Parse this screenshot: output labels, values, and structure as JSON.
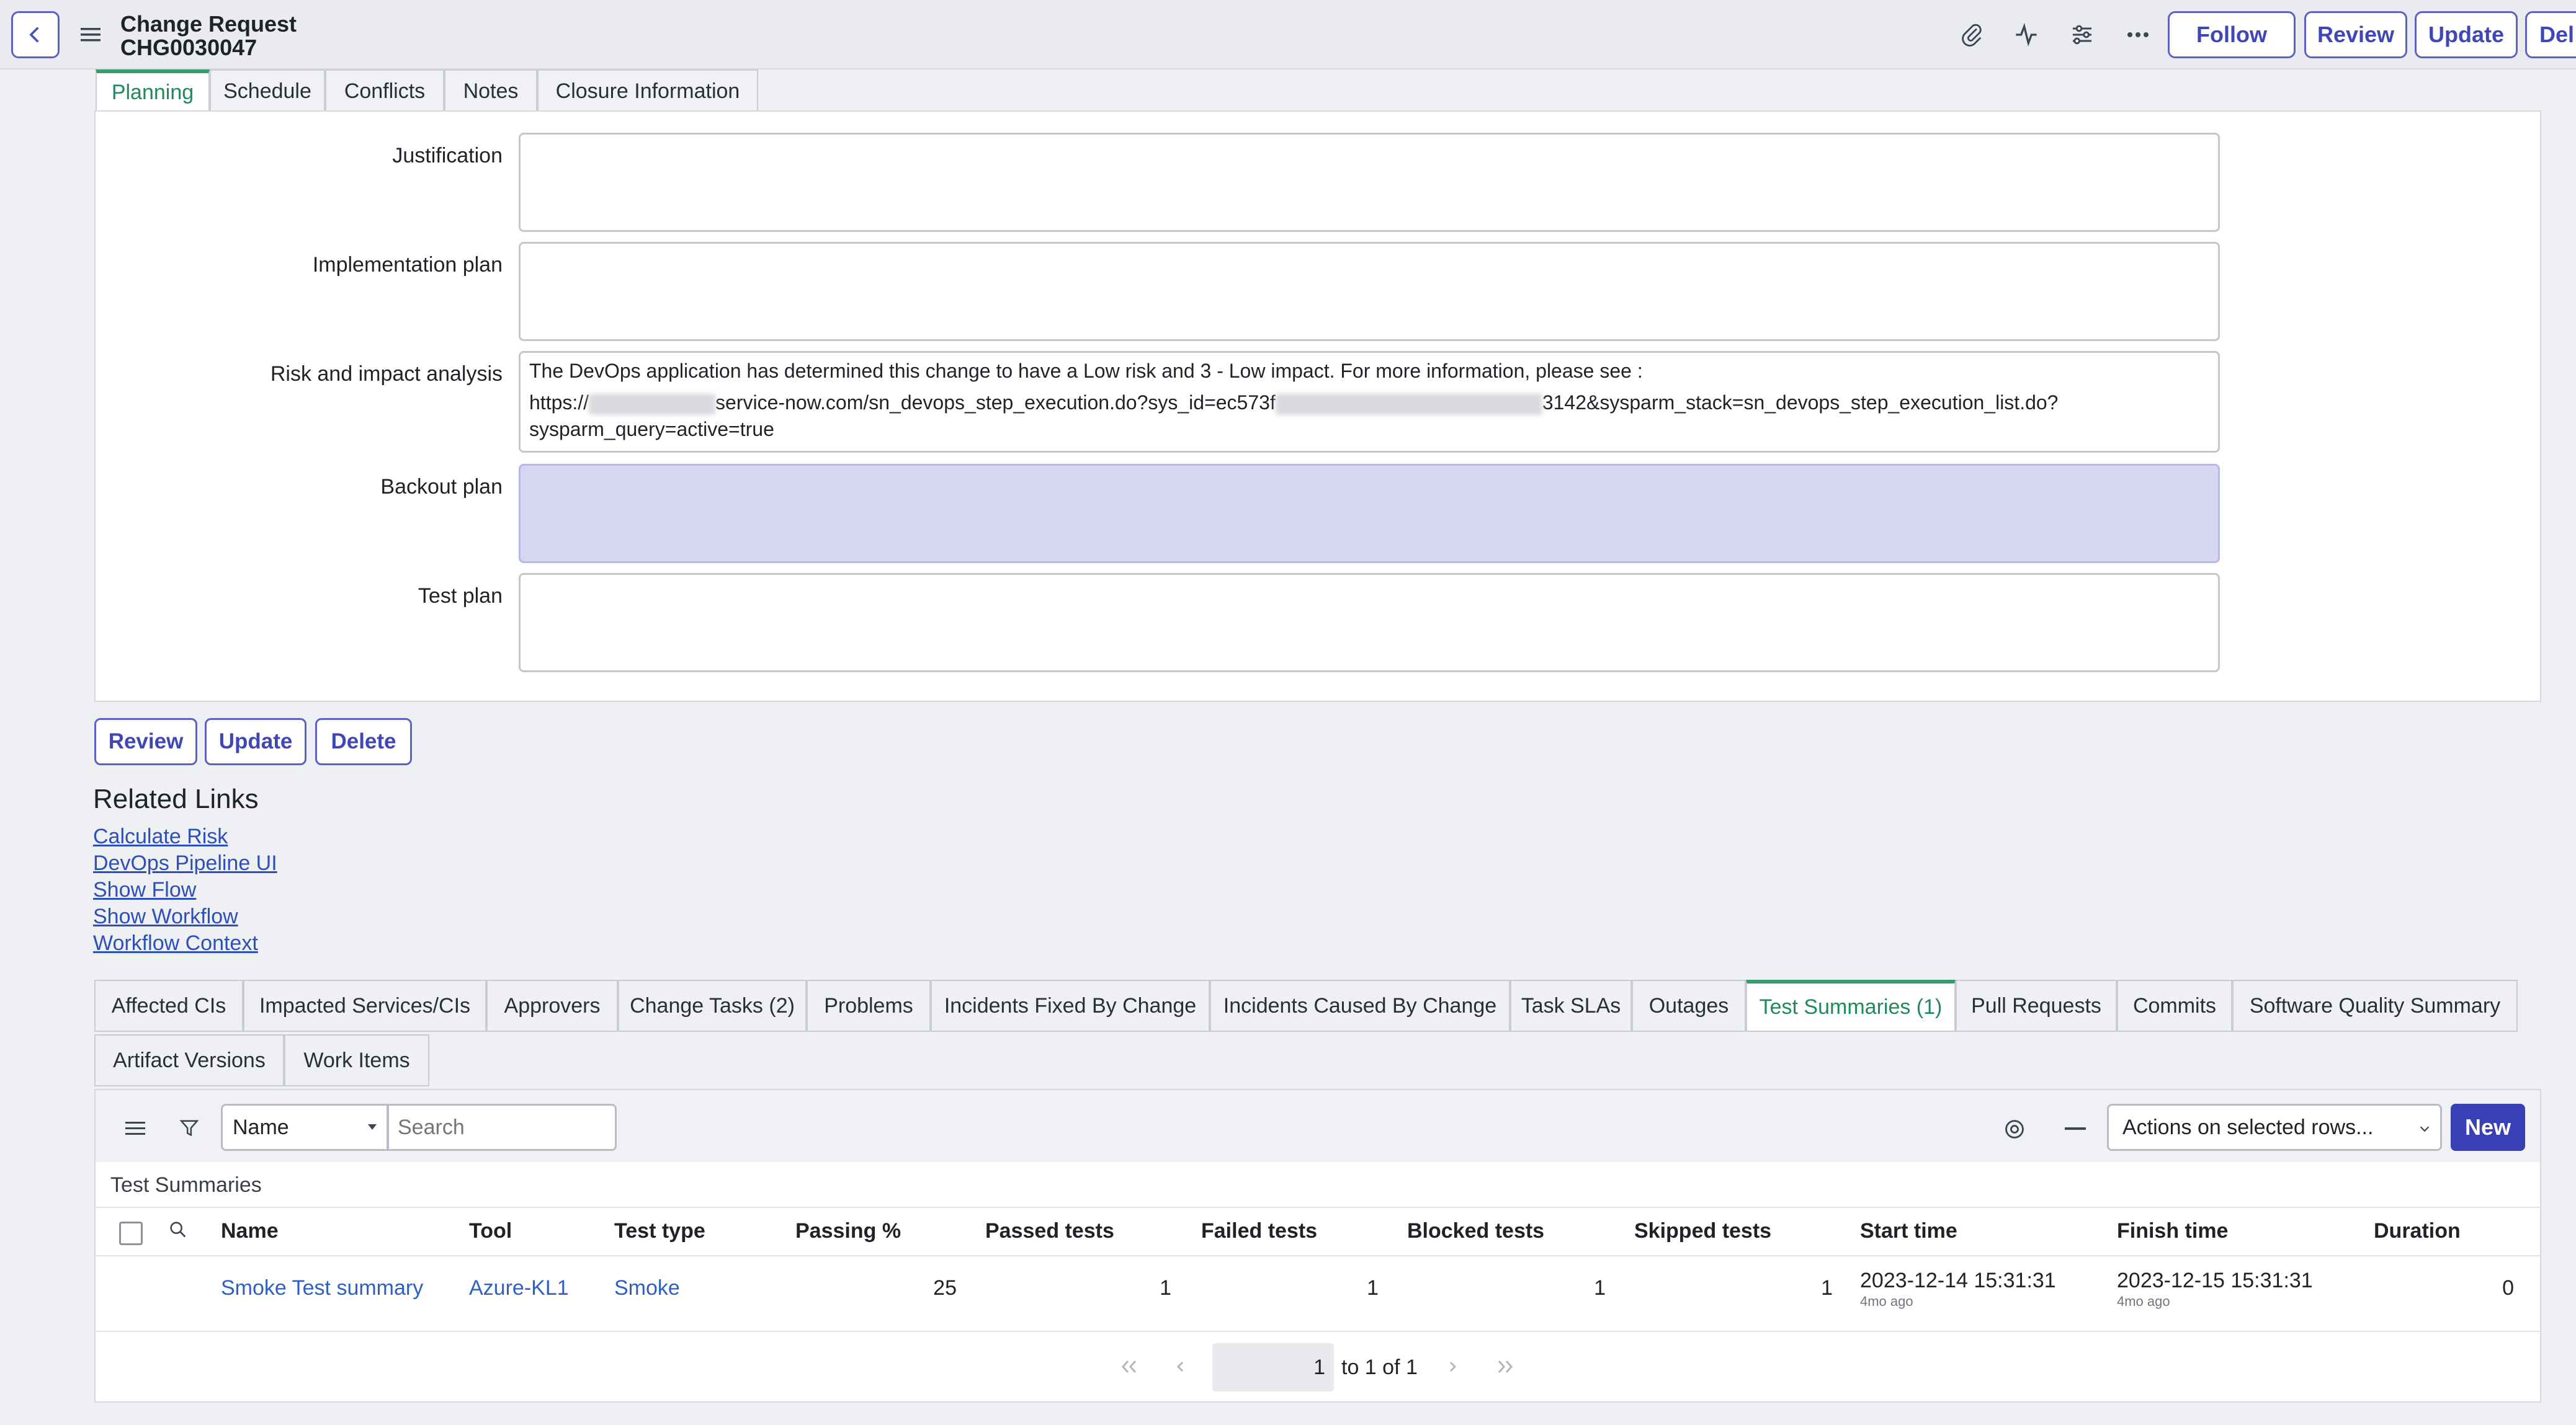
{
  "header": {
    "record_type": "Change Request",
    "record_number": "CHG0030047",
    "buttons": {
      "follow": "Follow",
      "review": "Review",
      "update": "Update",
      "delete": "Del"
    },
    "icons": {
      "back": "chevron-left-icon",
      "menu": "hamburger-icon",
      "attach": "paperclip-icon",
      "activity": "pulse-icon",
      "settings": "sliders-icon",
      "more": "ellipsis-icon"
    }
  },
  "form_tabs": [
    "Planning",
    "Schedule",
    "Conflicts",
    "Notes",
    "Closure Information"
  ],
  "fields": {
    "justification": {
      "label": "Justification",
      "value": ""
    },
    "implementation_plan": {
      "label": "Implementation plan",
      "value": ""
    },
    "risk_analysis": {
      "label": "Risk and impact analysis",
      "line1": "The DevOps application has determined this change to have a Low risk and 3 - Low impact. For more information, please see :",
      "line2_a": "https://",
      "line2_b": "service-now.com/sn_devops_step_execution.do?sys_id=ec573f",
      "line2_c": "3142&sysparm_stack=sn_devops_step_execution_list.do?",
      "line3": "sysparm_query=active=true"
    },
    "backout_plan": {
      "label": "Backout plan",
      "value": ""
    },
    "test_plan": {
      "label": "Test plan",
      "value": ""
    }
  },
  "form_buttons": {
    "review": "Review",
    "update": "Update",
    "delete": "Delete"
  },
  "related_links": {
    "title": "Related Links",
    "links": [
      "Calculate Risk",
      "DevOps Pipeline UI",
      "Show Flow",
      "Show Workflow",
      "Workflow Context"
    ]
  },
  "related_tabs_row1": [
    "Affected CIs",
    "Impacted Services/CIs",
    "Approvers",
    "Change Tasks (2)",
    "Problems",
    "Incidents Fixed By Change",
    "Incidents Caused By Change",
    "Task SLAs",
    "Outages",
    "Test Summaries (1)",
    "Pull Requests",
    "Commits",
    "Software Quality Summary"
  ],
  "related_tabs_row2": [
    "Artifact Versions",
    "Work Items"
  ],
  "list_toolbar": {
    "field_select": "Name",
    "search_placeholder": "Search",
    "actions_select": "Actions on selected rows...",
    "new_button": "New"
  },
  "list": {
    "title": "Test Summaries",
    "columns": [
      "Name",
      "Tool",
      "Test type",
      "Passing %",
      "Passed tests",
      "Failed tests",
      "Blocked tests",
      "Skipped tests",
      "Start time",
      "Finish time",
      "Duration"
    ],
    "rows": [
      {
        "name": "Smoke Test summary",
        "tool": "Azure-KL1",
        "test_type": "Smoke",
        "passing": "25",
        "passed": "1",
        "failed": "1",
        "blocked": "1",
        "skipped": "1",
        "start_time": "2023-12-14 15:31:31",
        "start_rel": "4mo ago",
        "finish_time": "2023-12-15 15:31:31",
        "finish_rel": "4mo ago",
        "duration": "0"
      }
    ]
  },
  "pagination": {
    "current": "1",
    "range_text": "to 1 of 1"
  },
  "colors": {
    "accent": "#3f47b8",
    "active_tab": "#2e9e6b",
    "link": "#2d5fc4",
    "highlight_field": "#d6d6f2"
  }
}
